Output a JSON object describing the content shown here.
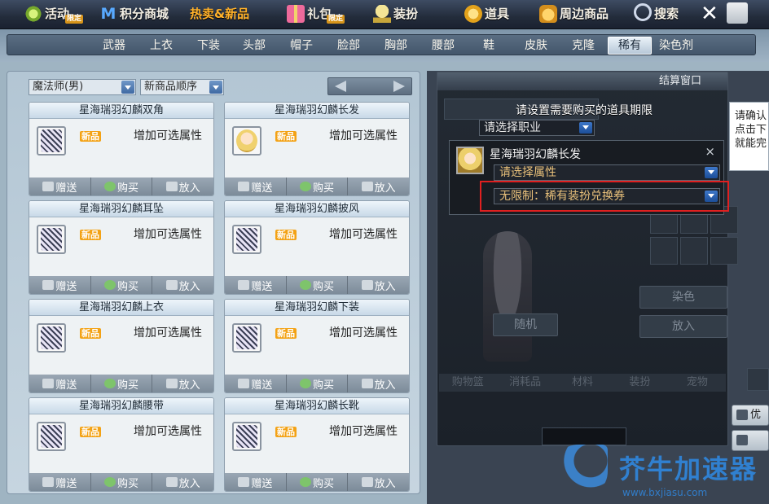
{
  "top_menu": [
    {
      "label": "活动",
      "badge": "限定",
      "icon": "star-icon"
    },
    {
      "label": "积分商城",
      "badge": "",
      "icon": "m-logo-icon"
    },
    {
      "label": "热卖&新品",
      "badge": "",
      "icon": ""
    },
    {
      "label": "礼包",
      "badge": "限定",
      "icon": "gift-icon"
    },
    {
      "label": "装扮",
      "badge": "",
      "icon": "trophy-icon"
    },
    {
      "label": "道具",
      "badge": "",
      "icon": "coin-icon"
    },
    {
      "label": "周边商品",
      "badge": "",
      "icon": "bag-icon"
    },
    {
      "label": "搜索",
      "badge": "",
      "icon": "search-icon"
    }
  ],
  "categories": [
    "武器",
    "上衣",
    "下装",
    "头部",
    "帽子",
    "脸部",
    "胸部",
    "腰部",
    "鞋",
    "皮肤",
    "克隆",
    "稀有",
    "染色剂"
  ],
  "active_category": "稀有",
  "filters": {
    "job": "魔法师(男)",
    "sort": "新商品顺序"
  },
  "products": [
    {
      "name": "星海瑞羽幻麟双角",
      "badge": "新品",
      "desc": "增加可选属性"
    },
    {
      "name": "星海瑞羽幻麟长发",
      "badge": "新品",
      "desc": "增加可选属性"
    },
    {
      "name": "星海瑞羽幻麟耳坠",
      "badge": "新品",
      "desc": "增加可选属性"
    },
    {
      "name": "星海瑞羽幻麟披风",
      "badge": "新品",
      "desc": "增加可选属性"
    },
    {
      "name": "星海瑞羽幻麟上衣",
      "badge": "新品",
      "desc": "增加可选属性"
    },
    {
      "name": "星海瑞羽幻麟下装",
      "badge": "新品",
      "desc": "增加可选属性"
    },
    {
      "name": "星海瑞羽幻麟腰带",
      "badge": "新品",
      "desc": "增加可选属性"
    },
    {
      "name": "星海瑞羽幻麟长靴",
      "badge": "新品",
      "desc": "增加可选属性"
    }
  ],
  "card_buttons": {
    "gift": "赠送",
    "buy": "购买",
    "cart": "放入"
  },
  "checkout": {
    "title": "结算窗口",
    "dye_button": "染色",
    "put_button": "放入",
    "random_button": "随机",
    "tabs": [
      "购物篮",
      "消耗品",
      "材料",
      "装扮",
      "宠物"
    ]
  },
  "side_notice": [
    "请确认",
    "点击下",
    "就能完"
  ],
  "side_buttons": [
    "优",
    ""
  ],
  "dialog": {
    "title": "请设置需要购买的道具期限",
    "job_select": "请选择职业",
    "item_name": "星海瑞羽幻麟长发",
    "close": "×",
    "attr_select": "请选择属性",
    "period_select": "无限制：稀有装扮兑换券"
  },
  "watermark": {
    "text": "芥牛加速器",
    "url": "www.bxjiasu.com"
  }
}
